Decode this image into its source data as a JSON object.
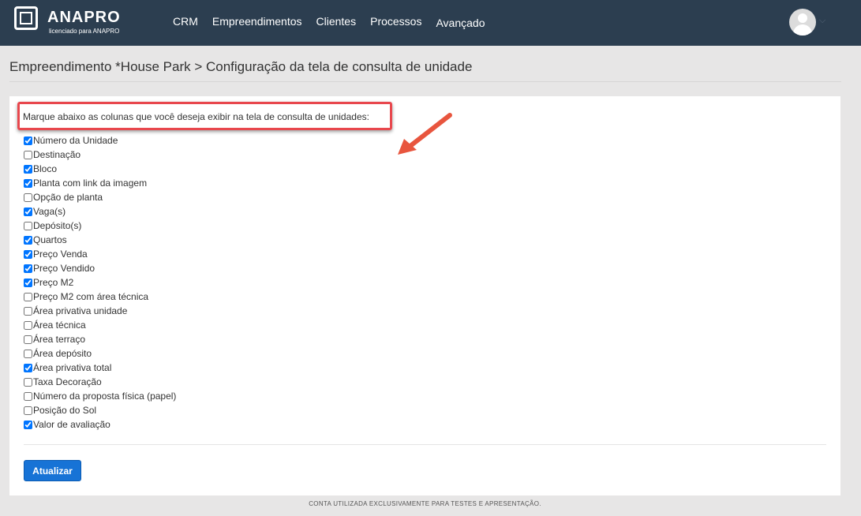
{
  "header": {
    "logo_name": "ANAPRO",
    "logo_subtitle": "licenciado para ANAPRO",
    "nav": [
      "CRM",
      "Empreendimentos",
      "Clientes",
      "Processos",
      "Avançado"
    ]
  },
  "breadcrumb": "Empreendimento *House Park > Configuração da tela de consulta de unidade",
  "instruction": "Marque abaixo as colunas que você deseja exibir na tela de consulta de unidades:",
  "columns": [
    {
      "label": "Número da Unidade",
      "checked": true
    },
    {
      "label": "Destinação",
      "checked": false
    },
    {
      "label": "Bloco",
      "checked": true
    },
    {
      "label": "Planta com link da imagem",
      "checked": true
    },
    {
      "label": "Opção de planta",
      "checked": false
    },
    {
      "label": "Vaga(s)",
      "checked": true
    },
    {
      "label": "Depósito(s)",
      "checked": false
    },
    {
      "label": "Quartos",
      "checked": true
    },
    {
      "label": "Preço Venda",
      "checked": true
    },
    {
      "label": "Preço Vendido",
      "checked": true
    },
    {
      "label": "Preço M2",
      "checked": true
    },
    {
      "label": "Preço M2 com área técnica",
      "checked": false
    },
    {
      "label": "Área privativa unidade",
      "checked": false
    },
    {
      "label": "Área técnica",
      "checked": false
    },
    {
      "label": "Área terraço",
      "checked": false
    },
    {
      "label": "Área depósito",
      "checked": false
    },
    {
      "label": "Área privativa total",
      "checked": true
    },
    {
      "label": "Taxa Decoração",
      "checked": false
    },
    {
      "label": "Número da proposta física (papel)",
      "checked": false
    },
    {
      "label": "Posição do Sol",
      "checked": false
    },
    {
      "label": "Valor de avaliação",
      "checked": true
    }
  ],
  "update_button": "Atualizar",
  "footer": "CONTA UTILIZADA EXCLUSIVAMENTE PARA TESTES E APRESENTAÇÃO.",
  "colors": {
    "header_bg": "#2c3e50",
    "button": "#1773d6",
    "highlight": "#e8474d"
  },
  "icons": [
    "anapro-logo-icon",
    "user-avatar-icon",
    "chevron-down-icon",
    "annotation-arrow-icon"
  ]
}
